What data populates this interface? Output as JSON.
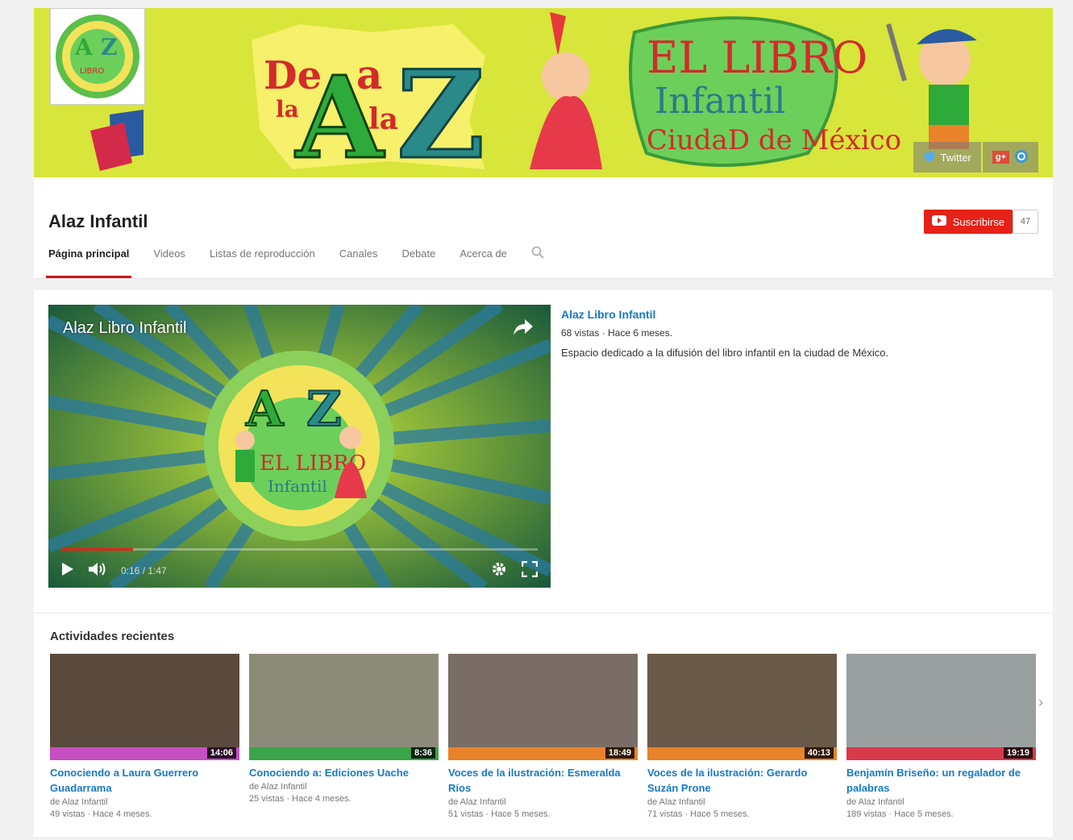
{
  "channel": {
    "name": "Alaz Infantil",
    "subscribe_label": "Suscribirse",
    "subscriber_count": "47"
  },
  "banner": {
    "social": [
      {
        "label": "Twitter",
        "icon": "twitter-icon"
      },
      {
        "label": "",
        "icon": "google-plus-icon"
      },
      {
        "label": "",
        "icon": "website-icon"
      }
    ],
    "colors": {
      "background": "#d8e53a"
    }
  },
  "tabs": [
    {
      "label": "Página principal",
      "active": true
    },
    {
      "label": "Videos",
      "active": false
    },
    {
      "label": "Listas de reproducción",
      "active": false
    },
    {
      "label": "Canales",
      "active": false
    },
    {
      "label": "Debate",
      "active": false
    },
    {
      "label": "Acerca de",
      "active": false
    }
  ],
  "featured": {
    "player_title": "Alaz Libro Infantil",
    "time": "0:16 / 1:47",
    "progress": 0.15,
    "title": "Alaz Libro Infantil",
    "meta": "68 vistas · Hace 6 meses.",
    "description": "Espacio dedicado a la difusión del libro infantil en la ciudad de México."
  },
  "recent": {
    "title": "Actividades recientes",
    "videos": [
      {
        "title": "Conociendo a Laura Guerrero Guadarrama",
        "author": "de Alaz Infantil",
        "meta": "49 vistas · Hace 4 meses.",
        "duration": "14:06",
        "strip_color": "#c64fc1",
        "thumb_color": "#5a4a3e"
      },
      {
        "title": "Conociendo a: Ediciones Uache",
        "author": "de Alaz Infantil",
        "meta": "25 vistas · Hace 4 meses.",
        "duration": "8:36",
        "strip_color": "#3aa54a",
        "thumb_color": "#8c8a78"
      },
      {
        "title": "Voces de la ilustración: Esmeralda Ríos",
        "author": "de Alaz Infantil",
        "meta": "51 vistas · Hace 5 meses.",
        "duration": "18:49",
        "strip_color": "#e8832a",
        "thumb_color": "#7a6d66"
      },
      {
        "title": "Voces de la ilustración: Gerardo Suzán Prone",
        "author": "de Alaz Infantil",
        "meta": "71 vistas · Hace 5 meses.",
        "duration": "40:13",
        "strip_color": "#e8832a",
        "thumb_color": "#6a5a4a"
      },
      {
        "title": "Benjamín Briseño: un regalador de palabras",
        "author": "de Alaz Infantil",
        "meta": "189 vistas · Hace 5 meses.",
        "duration": "19:19",
        "strip_color": "#d93a4a",
        "thumb_color": "#9aa0a0"
      }
    ]
  }
}
